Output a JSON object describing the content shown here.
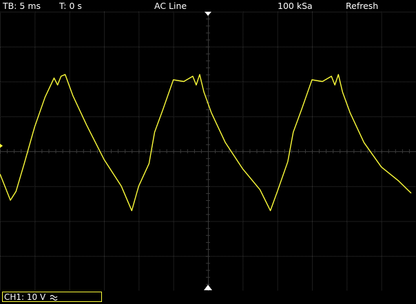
{
  "status": {
    "timebase": "TB: 5 ms",
    "trigger_position": "T: 0 s",
    "trigger_source": "AC Line",
    "sample_rate": "100 kSa",
    "acquisition_mode": "Refresh"
  },
  "channel": {
    "label": "CH1: 10 V",
    "coupling_icon": "ac-coupling-icon",
    "color": "#ffff3a"
  },
  "grid": {
    "h_divs": 12,
    "v_divs": 8,
    "color": "#3a3a3a"
  },
  "trace": {
    "color": "#ffff3a",
    "t_per_div_ms": 5,
    "v_per_div": 10,
    "samples_time_ms": [
      0,
      1.5,
      2.3,
      3.5,
      5,
      6.5,
      7.8,
      8.3,
      8.8,
      9.4,
      10.5,
      12.5,
      15,
      17.5,
      19,
      20,
      21.5,
      22.3,
      23.5,
      25,
      26.5,
      27.8,
      28.3,
      28.8,
      29.4,
      30.5,
      32.5,
      35,
      37.5,
      39,
      40,
      41.5,
      42.3,
      43.5,
      45,
      46.5,
      47.8,
      48.3,
      48.8,
      49.4,
      50.5,
      52.5,
      55,
      57.5,
      59.3
    ],
    "samples_voltage_v": [
      -6.5,
      -14,
      -11.5,
      -3.5,
      7,
      15.5,
      21,
      19,
      21.5,
      22,
      16,
      7.5,
      -2.3,
      -10,
      -17,
      -10,
      -3.5,
      5.5,
      12,
      20.5,
      20,
      21.5,
      19,
      22,
      17,
      11,
      2.5,
      -5,
      -11,
      -17,
      -11.5,
      -3,
      5.5,
      12,
      20.5,
      20,
      21.5,
      19,
      22,
      17,
      11,
      2.5,
      -4.5,
      -8.5,
      -12
    ]
  }
}
